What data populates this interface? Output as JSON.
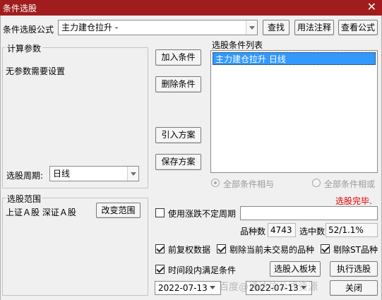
{
  "window": {
    "title": "条件选股",
    "close_glyph": "✕"
  },
  "formula": {
    "label": "条件选股公式",
    "value": "主力建仓拉升 -",
    "buttons": {
      "find": "查找",
      "usage": "用法注释",
      "view": "查看公式"
    }
  },
  "params": {
    "legend": "计算参数",
    "message": "无参数需要设置",
    "period_label": "选股周期:",
    "period_value": "日线"
  },
  "actions": {
    "add": "加入条件",
    "delete": "删除条件",
    "import": "引入方案",
    "save": "保存方案"
  },
  "conditions": {
    "label": "选股条件列表",
    "items": [
      "主力建仓拉升  日线"
    ],
    "radio_and": "全部条件相与",
    "radio_or": "全部条件相或",
    "status": "选股完毕."
  },
  "scope": {
    "legend": "选股范围",
    "value": "上证Ａ股 深证Ａ股",
    "change_button": "改变范围"
  },
  "options": {
    "variable_period_label": "使用涨跌不定周期",
    "variable_period_value": "",
    "count_label": "品种数",
    "count_value": "4743",
    "selected_label": "选中数",
    "selected_value": "52/1.1%",
    "forward_adjust": "前复权数据",
    "exclude_untraded": "剔除当前未交易的品种",
    "exclude_st": "剔除ST品种",
    "time_range": "时间段内满足条件",
    "add_to_block": "选股入板块",
    "execute": "执行选股",
    "date_from": "2022-07-13",
    "date_to": "2022-07-13",
    "close": "关闭"
  },
  "watermark": "百度@通达信公式资源"
}
